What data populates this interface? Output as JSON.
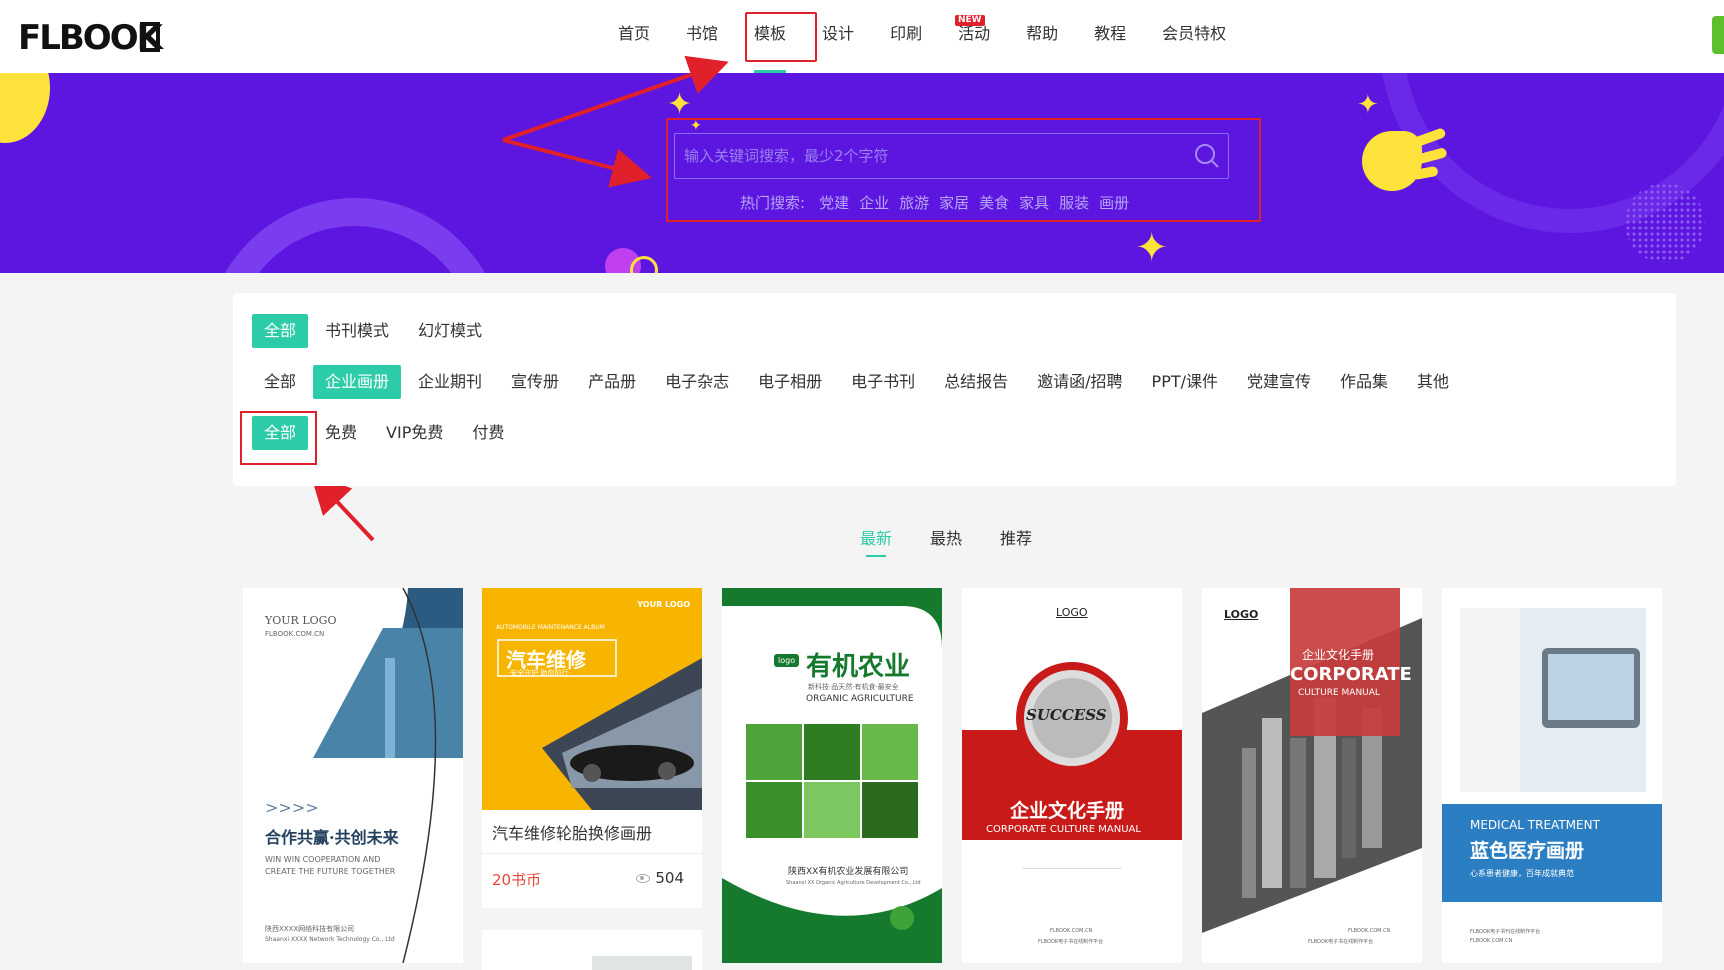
{
  "header": {
    "logo": "FLBOOK",
    "nav": [
      {
        "label": "首页"
      },
      {
        "label": "书馆"
      },
      {
        "label": "模板",
        "active": true
      },
      {
        "label": "设计"
      },
      {
        "label": "印刷",
        "badge": "NEW"
      },
      {
        "label": "活动"
      },
      {
        "label": "帮助"
      },
      {
        "label": "教程"
      },
      {
        "label": "会员特权"
      }
    ]
  },
  "banner": {
    "search_placeholder": "输入关键词搜索，最少2个字符",
    "hot_label": "热门搜索:",
    "hot_terms": [
      "党建",
      "企业",
      "旅游",
      "家居",
      "美食",
      "家具",
      "服装",
      "画册"
    ]
  },
  "filters": {
    "mode": [
      "全部",
      "书刊模式",
      "幻灯模式"
    ],
    "category": [
      "全部",
      "企业画册",
      "企业期刊",
      "宣传册",
      "产品册",
      "电子杂志",
      "电子相册",
      "电子书刊",
      "总结报告",
      "邀请函/招聘",
      "PPT/课件",
      "党建宣传",
      "作品集",
      "其他"
    ],
    "price": [
      "全部",
      "免费",
      "VIP免费",
      "付费"
    ]
  },
  "sort": [
    "最新",
    "最热",
    "推荐"
  ],
  "cards": {
    "c1": {
      "logo": "YOUR LOGO",
      "site": "FLBOOK.COM.CN",
      "chevrons": ">>>>",
      "title": "合作共赢·共创未来",
      "sub1": "WIN WIN COOPERATION AND",
      "sub2": "CREATE THE FUTURE TOGETHER",
      "company": "陕西XXXX网络科技有限公司",
      "company_en": "Shaanxi XXXX Network Technology Co., Ltd"
    },
    "c2": {
      "your_logo": "YOUR LOGO",
      "album": "AUTOMOBILE MAINTENANCE ALBUM",
      "cover_title": "汽车维修",
      "cover_sub": "·安全守护 助你前行·",
      "title": "汽车维修轮胎换修画册",
      "price": "20书币",
      "views": "504"
    },
    "c3": {
      "logo": "logo",
      "title": "有机农业",
      "tagline": "新科技·品天然·有机食·最安全",
      "en": "ORGANIC AGRICULTURE",
      "company": "陕西XX有机农业发展有限公司",
      "company_en": "Shaanxi XX Organic Agriculture Development Co., Ltd"
    },
    "c4": {
      "logo": "LOGO",
      "badge": "SUCCESS",
      "title": "企业文化手册",
      "en": "CORPORATE CULTURE MANUAL",
      "footer1": "FLBOOK.COM.CN",
      "footer2": "FLBOOK电子书在线制作平台"
    },
    "c5": {
      "logo": "LOGO",
      "zh": "企业文化手册",
      "big": "CORPORATE",
      "en": "CULTURE MANUAL",
      "footer1": "FLBOOK.COM.CN",
      "footer2": "FLBOOK电子书在线制作平台"
    },
    "c6": {
      "en": "MEDICAL TREATMENT",
      "title": "蓝色医疗画册",
      "sub": "心系患者健康，百年成就典范",
      "footer1": "FLBOOK电子书刊在线制作平台",
      "footer2": "FLBOOK.COM.CN"
    }
  },
  "colors": {
    "accent": "#2dcca8",
    "banner": "#5c16e0",
    "annotation": "#e0202a"
  }
}
